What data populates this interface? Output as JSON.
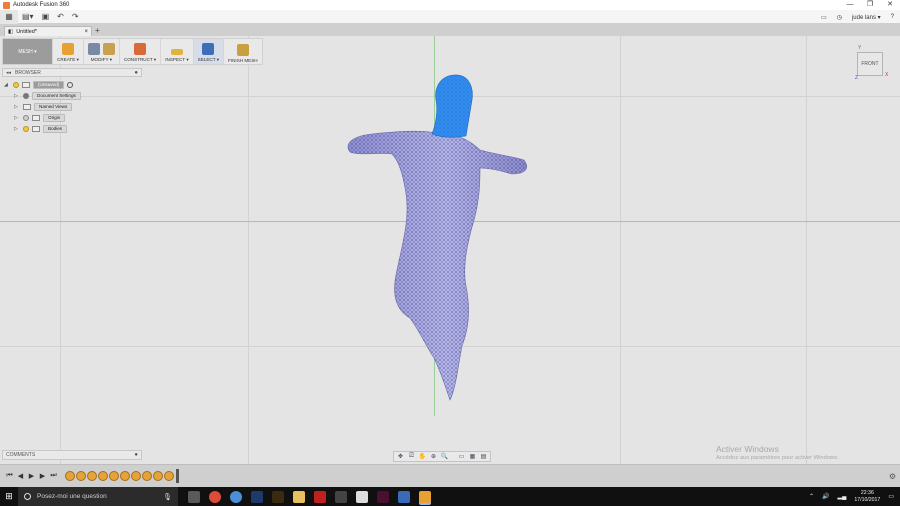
{
  "window": {
    "title": "Autodesk Fusion 360",
    "controls": [
      "—",
      "❐",
      "✕"
    ]
  },
  "quick_access": {
    "user": "jude lans ▾",
    "help": "?",
    "undo": "↶",
    "redo": "↷"
  },
  "doc_tab": {
    "label": "Untitled*"
  },
  "toolbar": {
    "workspace": "MESH ▾",
    "tools": [
      {
        "label": "CREATE ▾"
      },
      {
        "label": "MODIFY ▾"
      },
      {
        "label": "CONSTRUCT ▾"
      },
      {
        "label": "INSPECT ▾"
      },
      {
        "label": "SELECT ▾"
      },
      {
        "label": "FINISH MESH"
      }
    ]
  },
  "browser": {
    "header": "BROWSER",
    "items": [
      {
        "label": "(Unsaved)"
      },
      {
        "label": "Document Settings"
      },
      {
        "label": "Named Views"
      },
      {
        "label": "Origin"
      },
      {
        "label": "Bodies"
      }
    ]
  },
  "viewcube": {
    "face": "FRONT",
    "y": "Y",
    "x": "X",
    "z": "Z"
  },
  "comments": {
    "label": "COMMENTS"
  },
  "watermark": {
    "line1": "Activer Windows",
    "line2": "Accédez aux paramètres pour activer Windows."
  },
  "taskbar": {
    "search_placeholder": "Posez-moi une question",
    "time": "22:36",
    "date": "17/10/2017"
  },
  "colors": {
    "mesh_body": "#9f9fe0",
    "mesh_selected": "#2f8cf0",
    "axis_red": "#e7a3a3",
    "axis_green": "#9ccf98"
  }
}
